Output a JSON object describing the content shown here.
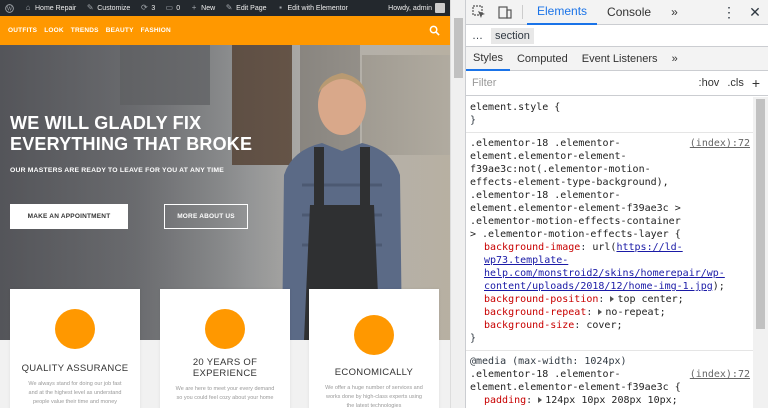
{
  "admin_bar": {
    "site_name": "Home Repair",
    "customize": "Customize",
    "updates_count": "3",
    "comments_count": "0",
    "new": "New",
    "edit_page": "Edit Page",
    "edit_elementor": "Edit with Elementor",
    "howdy": "Howdy, admin"
  },
  "nav": {
    "items": [
      "OUTFITS",
      "LOOK",
      "TRENDS",
      "BEAUTY",
      "FASHION"
    ]
  },
  "hero": {
    "title": "WE WILL GLADLY FIX EVERYTHING THAT BROKE",
    "subtitle": "OUR MASTERS ARE READY TO LEAVE FOR YOU AT ANY TIME",
    "primary_button": "MAKE AN APPOINTMENT",
    "secondary_button": "MORE ABOUT US"
  },
  "features": [
    {
      "title": "QUALITY ASSURANCE",
      "text": "We always stand for doing our job fast and at the highest level as understand people value their time and money"
    },
    {
      "title": "20 YEARS OF EXPERIENCE",
      "text": "We are here to meet your every demand so you could feel cozy about your home"
    },
    {
      "title": "ECONOMICALLY",
      "text": "We offer a huge number of services and works done by high-class experts using the latest technologies"
    }
  ],
  "devtools": {
    "tabs": [
      "Elements",
      "Console"
    ],
    "active_tab": "Elements",
    "breadcrumb": "section",
    "subtabs": [
      "Styles",
      "Computed",
      "Event Listeners"
    ],
    "filter_placeholder": "Filter",
    "hov": ":hov",
    "cls": ".cls",
    "add": "+",
    "element_style": "element.style {",
    "close_brace": "}",
    "rule1": {
      "source": "(index):72",
      "selector": ".elementor-18 .elementor-element.elementor-element-f39ae3c:not(.elementor-motion-effects-element-type-background), .elementor-18 .elementor-element.elementor-element-f39ae3c > .elementor-motion-effects-container > .elementor-motion-effects-layer {",
      "bg_image_name": "background-image",
      "bg_image_pre": "url(",
      "bg_image_url": "https://ld-wp73.template-help.com/monstroid2/skins/homerepair/wp-content/uploads/2018/12/home-img-1.jpg",
      "bg_image_post": ");",
      "bg_position_name": "background-position",
      "bg_position_value": "top center;",
      "bg_repeat_name": "background-repeat",
      "bg_repeat_value": "no-repeat;",
      "bg_size_name": "background-size",
      "bg_size_value": "cover;"
    },
    "rule2": {
      "source": "(index):72",
      "media": "@media (max-width: 1024px)",
      "selector": ".elementor-18 .elementor-element.elementor-element-f39ae3c {",
      "padding_name": "padding",
      "padding_value": "124px 10px 208px 10px;"
    }
  },
  "colors": {
    "accent_orange": "#ff9800",
    "admin_bar_bg": "#23282d",
    "devtools_blue": "#1a73e8"
  }
}
